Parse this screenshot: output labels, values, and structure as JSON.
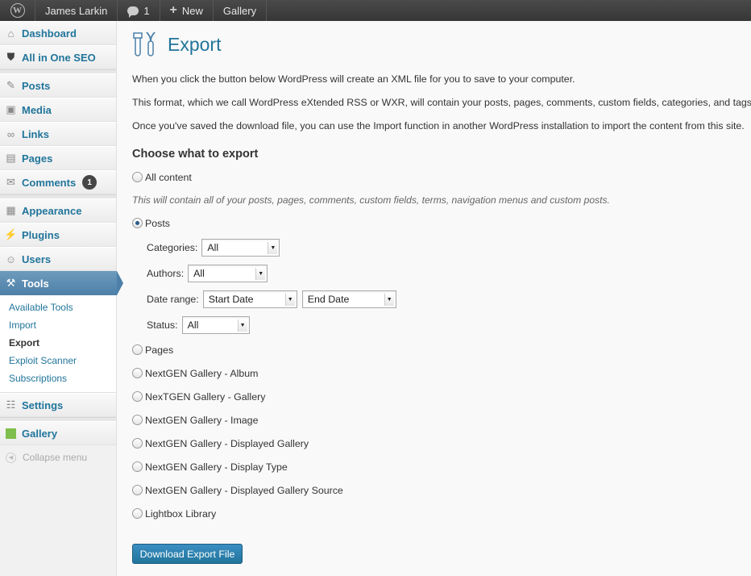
{
  "adminbar": {
    "user": "James Larkin",
    "comments_count": "1",
    "new_label": "New",
    "gallery_label": "Gallery"
  },
  "sidebar": {
    "items_top": [
      {
        "label": "Dashboard",
        "icon": "house-icon"
      },
      {
        "label": "All in One SEO",
        "icon": "shield-icon"
      }
    ],
    "items_content": [
      {
        "label": "Posts",
        "icon": "pushpin-icon"
      },
      {
        "label": "Media",
        "icon": "media-icon"
      },
      {
        "label": "Links",
        "icon": "link-icon"
      },
      {
        "label": "Pages",
        "icon": "pages-icon"
      },
      {
        "label": "Comments",
        "icon": "comments-icon",
        "badge": "1"
      }
    ],
    "items_admin": [
      {
        "label": "Appearance",
        "icon": "appearance-icon"
      },
      {
        "label": "Plugins",
        "icon": "plugin-icon"
      },
      {
        "label": "Users",
        "icon": "users-icon"
      }
    ],
    "tools": {
      "label": "Tools",
      "icon": "tools-icon"
    },
    "tools_submenu": [
      "Available Tools",
      "Import",
      "Export",
      "Exploit Scanner",
      "Subscriptions"
    ],
    "settings": {
      "label": "Settings",
      "icon": "settings-icon"
    },
    "gallery": {
      "label": "Gallery",
      "icon": "gallery-icon",
      "color": "#7fbf4d"
    },
    "collapse": "Collapse menu"
  },
  "main": {
    "title": "Export",
    "desc1": "When you click the button below WordPress will create an XML file for you to save to your computer.",
    "desc2": "This format, which we call WordPress eXtended RSS or WXR, will contain your posts, pages, comments, custom fields, categories, and tags.",
    "desc3": "Once you've saved the download file, you can use the Import function in another WordPress installation to import the content from this site.",
    "heading": "Choose what to export",
    "all_content": "All content",
    "all_note": "This will contain all of your posts, pages, comments, custom fields, terms, navigation menus and custom posts.",
    "posts": "Posts",
    "filters": {
      "categories_label": "Categories:",
      "categories_value": "All",
      "authors_label": "Authors:",
      "authors_value": "All",
      "date_label": "Date range:",
      "start_date": "Start Date",
      "end_date": "End Date",
      "status_label": "Status:",
      "status_value": "All"
    },
    "other_options": [
      "Pages",
      "NextGEN Gallery - Album",
      "NexTGEN Gallery - Gallery",
      "NextGEN Gallery - Image",
      "NextGEN Gallery - Displayed Gallery",
      "NextGEN Gallery - Display Type",
      "NextGEN Gallery - Displayed Gallery Source",
      "Lightbox Library"
    ],
    "download_button": "Download Export File"
  },
  "colors": {
    "link": "#21759b",
    "adminbar": "#464646",
    "active_menu": "#4d7fa8",
    "button": "#21759b"
  }
}
